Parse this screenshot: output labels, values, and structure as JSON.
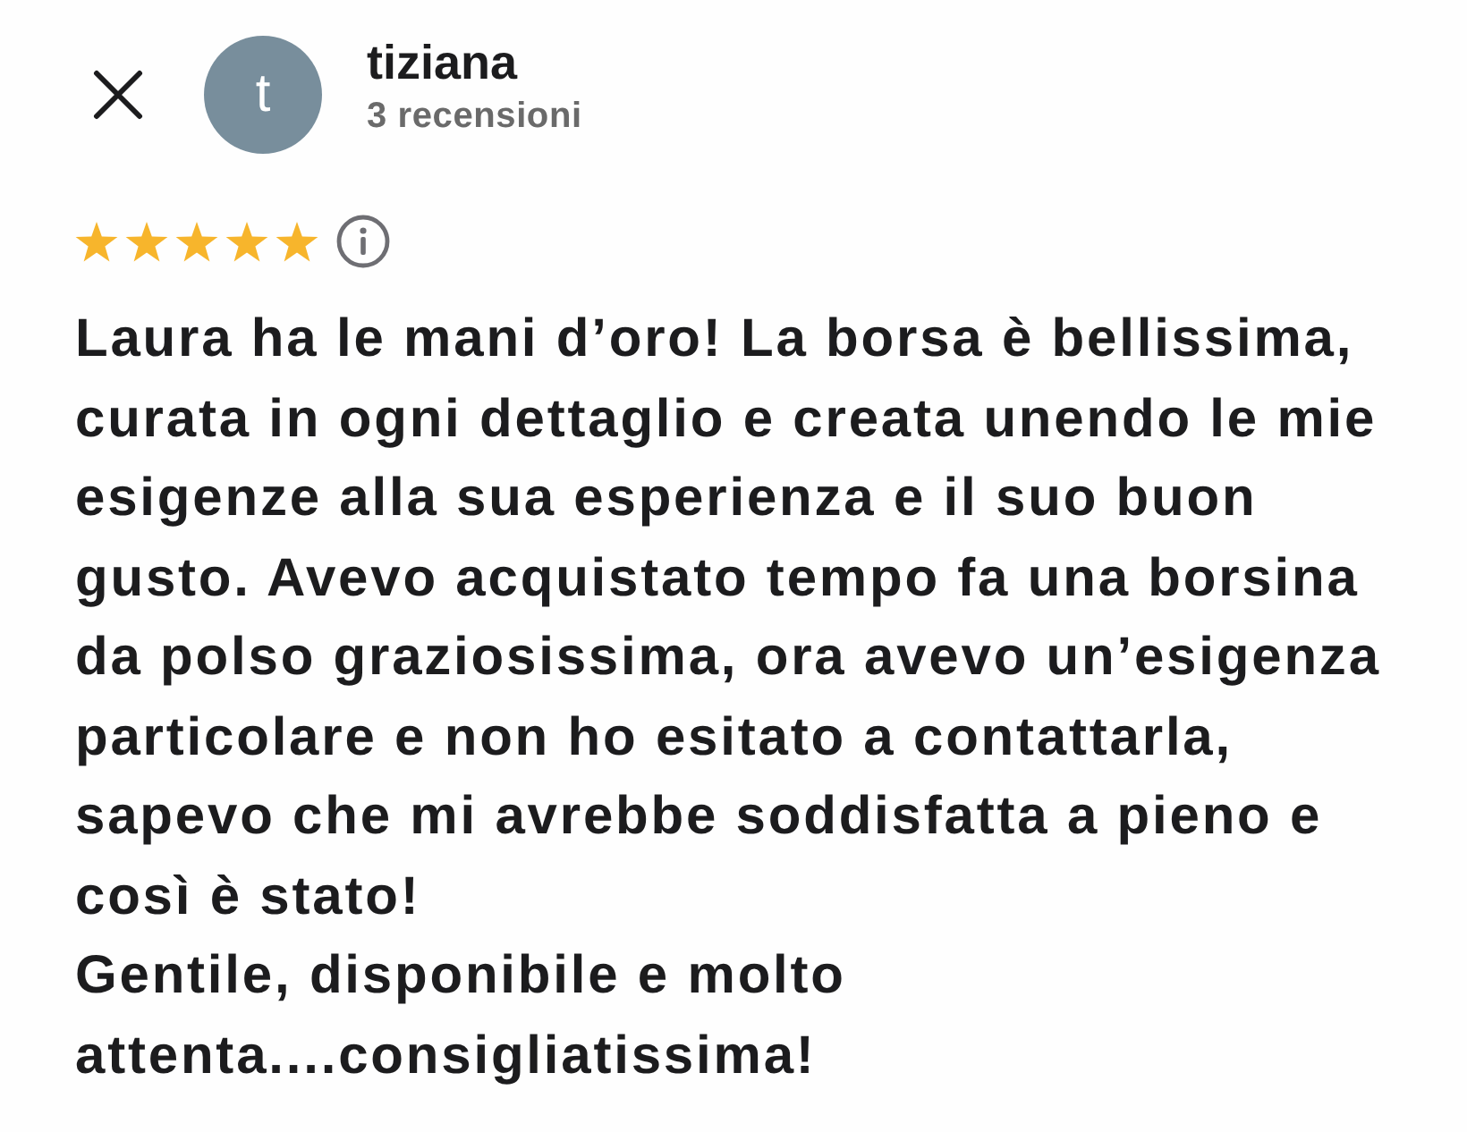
{
  "reviewer": {
    "initial": "t",
    "name": "tiziana",
    "review_count": "3 recensioni"
  },
  "rating": {
    "stars": 5
  },
  "review": {
    "paragraphs": [
      "Laura ha le mani d’oro! La borsa è bellissima, curata in ogni dettaglio e creata unendo le mie esigenze alla sua esperienza e il suo buon gusto. Avevo acquistato tempo fa una borsina da polso graziosissima, ora avevo un’esigenza particolare e non ho esitato a contattarla, sapevo che mi avrebbe soddisfatta a pieno e così è stato!",
      "Gentile, disponibile e molto attenta....consigliatissima!"
    ]
  }
}
